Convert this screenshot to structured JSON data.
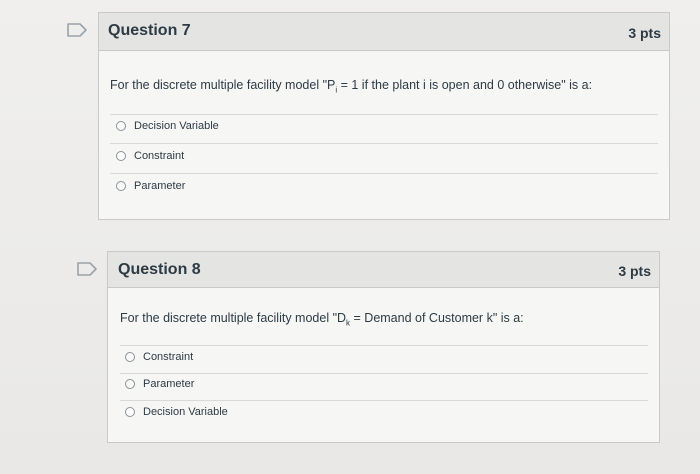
{
  "questions": [
    {
      "title": "Question 7",
      "points": "3 pts",
      "text_prefix": "For the discrete multiple facility model \"P",
      "text_sub": "i",
      "text_suffix": " = 1 if the plant i is open and 0 otherwise\" is a:",
      "answers": [
        "Decision Variable",
        "Constraint",
        "Parameter"
      ]
    },
    {
      "title": "Question 8",
      "points": "3 pts",
      "text_prefix": "For the discrete multiple facility model \"D",
      "text_sub": "k",
      "text_suffix": " = Demand of Customer k\" is a:",
      "answers": [
        "Constraint",
        "Parameter",
        "Decision Variable"
      ]
    }
  ],
  "flag_icon": "bookmark-flag-icon",
  "colors": {
    "text": "#2d3b45",
    "header_bg": "#e4e4e2",
    "card_bg": "#f6f6f5",
    "border": "#c9c9c7"
  }
}
